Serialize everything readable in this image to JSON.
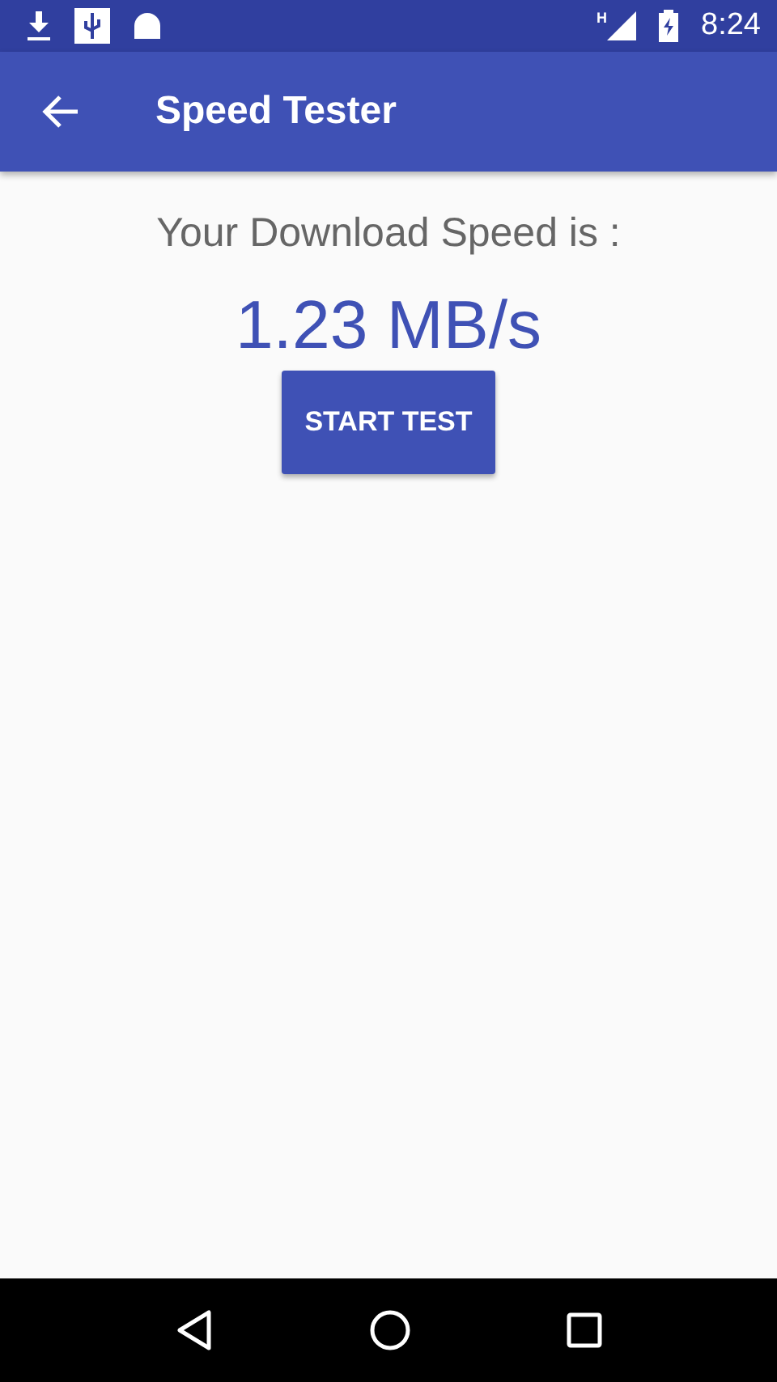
{
  "status_bar": {
    "time": "8:24",
    "network": "H"
  },
  "app_bar": {
    "title": "Speed Tester"
  },
  "content": {
    "label": "Your Download Speed is :",
    "speed": "1.23 MB/s",
    "button": "START TEST"
  }
}
